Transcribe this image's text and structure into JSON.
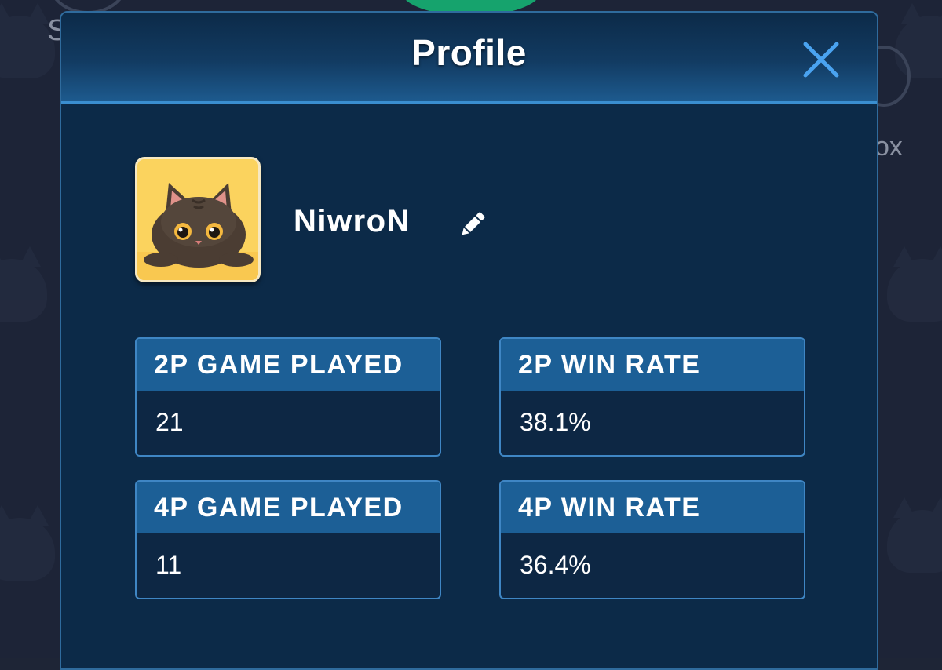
{
  "background": {
    "top_left_letter": "S",
    "right_label": "ox"
  },
  "dialog": {
    "title": "Profile",
    "close_icon": "close-icon"
  },
  "profile": {
    "avatar_icon": "cat-avatar",
    "username": "NiwroN",
    "edit_icon": "pencil-icon"
  },
  "stats": [
    {
      "label": "2P GAME PLAYED",
      "value": "21"
    },
    {
      "label": "2P WIN RATE",
      "value": "38.1%"
    },
    {
      "label": "4P GAME PLAYED",
      "value": "11"
    },
    {
      "label": "4P WIN RATE",
      "value": "36.4%"
    }
  ],
  "colors": {
    "dialog_bg": "#0c2a48",
    "header_accent": "#3a8ed0",
    "card_header": "#1c5f96",
    "card_border": "#3f86c4",
    "button_green": "#16a36d"
  }
}
